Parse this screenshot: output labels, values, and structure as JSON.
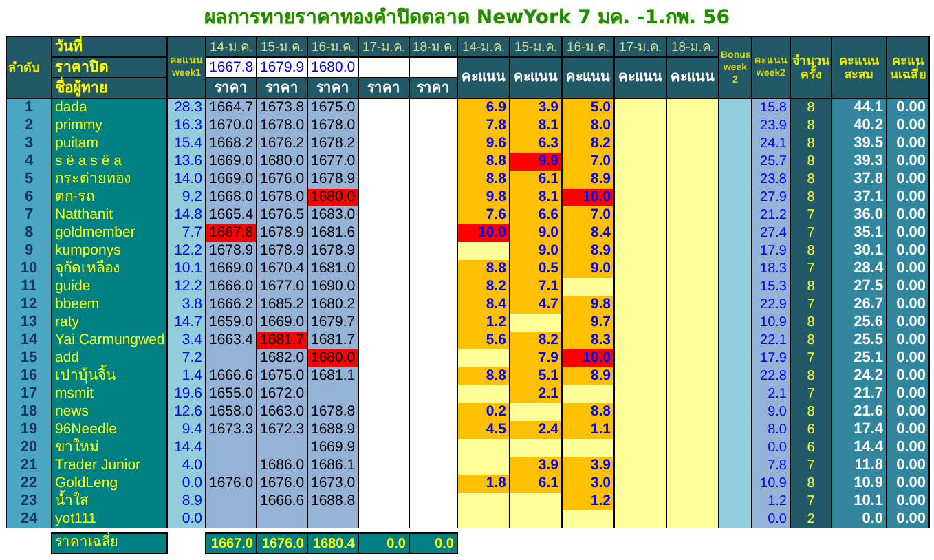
{
  "title": "ผลการทายราคาทองคำปิดตลาด NewYork 7 มค. -1.กพ. 56",
  "header": {
    "rank": "ลำดับ",
    "date_label": "วันที่",
    "closing_label": "ราคาปิด",
    "name_label": "ชื่อผู้ทาย",
    "week1": "คะแนน week1",
    "price_dates": [
      "14-ม.ค.",
      "15-ม.ค.",
      "16-ม.ค.",
      "17-ม.ค.",
      "18-ม.ค."
    ],
    "closing_prices": [
      "1667.8",
      "1679.9",
      "1680.0"
    ],
    "price_labels": [
      "ราคา",
      "ราคา",
      "ราคา",
      "ราคา",
      "ราคา"
    ],
    "score_dates": [
      "14-ม.ค.",
      "15-ม.ค.",
      "16-ม.ค.",
      "17-ม.ค.",
      "18-ม.ค."
    ],
    "score_labels": [
      "คะแนน",
      "คะแนน",
      "คะแนน",
      "คะแนน",
      "คะแนน"
    ],
    "bonus": "Bonus week 2",
    "week2": "คะแนน week2",
    "count": "จำนวนครั้ง",
    "total": "คะแนนสะสม",
    "average": "คะแนนเฉลี่ย"
  },
  "rows": [
    {
      "rank": "1",
      "name": "dada",
      "week1": "28.3",
      "prices": [
        "1664.7",
        "1673.8",
        "1675.0"
      ],
      "scores": [
        "6.9",
        "3.9",
        "5.0"
      ],
      "week2": "15.8",
      "count": "8",
      "total": "44.1",
      "average": "0.00"
    },
    {
      "rank": "2",
      "name": "primmy",
      "week1": "16.3",
      "prices": [
        "1670.0",
        "1678.0",
        "1678.0"
      ],
      "scores": [
        "7.8",
        "8.1",
        "8.0"
      ],
      "week2": "23.9",
      "count": "8",
      "total": "40.2",
      "average": "0.00"
    },
    {
      "rank": "3",
      "name": "puitam",
      "week1": "15.4",
      "prices": [
        "1668.2",
        "1676.2",
        "1678.2"
      ],
      "scores": [
        "9.6",
        "6.3",
        "8.2"
      ],
      "week2": "24.1",
      "count": "8",
      "total": "39.5",
      "average": "0.00"
    },
    {
      "rank": "4",
      "name": "s ë a s ë a",
      "week1": "13.6",
      "prices": [
        "1669.0",
        "1680.0",
        "1677.0"
      ],
      "scores": [
        "8.8",
        {
          "value": "9.9",
          "highlighted": true
        },
        "7.0"
      ],
      "week2": "25.7",
      "count": "8",
      "total": "39.3",
      "average": "0.00"
    },
    {
      "rank": "5",
      "name": "กระต่ายทอง",
      "week1": "14.0",
      "prices": [
        "1669.0",
        "1676.0",
        "1678.9"
      ],
      "scores": [
        "8.8",
        "6.1",
        "8.9"
      ],
      "week2": "23.8",
      "count": "8",
      "total": "37.8",
      "average": "0.00"
    },
    {
      "rank": "6",
      "name": "ตก-รถ",
      "week1": "9.2",
      "prices": [
        "1668.0",
        "1678.0",
        {
          "value": "1680.0",
          "highlighted": true
        }
      ],
      "scores": [
        "9.8",
        "8.1",
        {
          "value": "10.0",
          "highlighted": true
        }
      ],
      "week2": "27.9",
      "count": "8",
      "total": "37.1",
      "average": "0.00"
    },
    {
      "rank": "7",
      "name": "Natthanit",
      "week1": "14.8",
      "prices": [
        "1665.4",
        "1676.5",
        "1683.0"
      ],
      "scores": [
        "7.6",
        "6.6",
        "7.0"
      ],
      "week2": "21.2",
      "count": "7",
      "total": "36.0",
      "average": "0.00"
    },
    {
      "rank": "8",
      "name": "goldmember",
      "week1": "7.7",
      "prices": [
        {
          "value": "1667.8",
          "highlighted": true
        },
        "1678.9",
        "1681.6"
      ],
      "scores": [
        {
          "value": "10.0",
          "highlighted": true
        },
        "9.0",
        "8.4"
      ],
      "week2": "27.4",
      "count": "7",
      "total": "35.1",
      "average": "0.00"
    },
    {
      "rank": "9",
      "name": "kumponys",
      "week1": "12.2",
      "prices": [
        "1678.9",
        "1678.9",
        "1678.9"
      ],
      "scores": [
        {
          "kind": "blank"
        },
        "9.0",
        "8.9"
      ],
      "week2": "17.9",
      "count": "8",
      "total": "30.1",
      "average": "0.00"
    },
    {
      "rank": "10",
      "name": "จุกัดเหลือง",
      "week1": "10.1",
      "prices": [
        "1669.0",
        "1670.4",
        "1681.0"
      ],
      "scores": [
        "8.8",
        "0.5",
        "9.0"
      ],
      "week2": "18.3",
      "count": "7",
      "total": "28.4",
      "average": "0.00"
    },
    {
      "rank": "11",
      "name": "guide",
      "week1": "12.2",
      "prices": [
        "1666.0",
        "1677.0",
        "1690.0"
      ],
      "scores": [
        "8.2",
        "7.1"
      ],
      "week2": "15.3",
      "count": "8",
      "total": "27.5",
      "average": "0.00"
    },
    {
      "rank": "12",
      "name": "bbeem",
      "week1": "3.8",
      "prices": [
        "1666.2",
        "1685.2",
        "1680.2"
      ],
      "scores": [
        "8.4",
        "4.7",
        "9.8"
      ],
      "week2": "22.9",
      "count": "7",
      "total": "26.7",
      "average": "0.00"
    },
    {
      "rank": "13",
      "name": "raty",
      "week1": "14.7",
      "prices": [
        "1659.0",
        "1669.0",
        "1679.7"
      ],
      "scores": [
        "1.2",
        {
          "kind": "blank"
        },
        "9.7"
      ],
      "week2": "10.9",
      "count": "8",
      "total": "25.6",
      "average": "0.00"
    },
    {
      "rank": "14",
      "name": "Yai Carmungwed",
      "week1": "3.4",
      "prices": [
        "1663.4",
        {
          "value": "1681.7",
          "highlighted": true
        },
        "1681.7"
      ],
      "scores": [
        "5.6",
        "8.2",
        "8.3"
      ],
      "week2": "22.1",
      "count": "8",
      "total": "25.5",
      "average": "0.00"
    },
    {
      "rank": "15",
      "name": "add",
      "week1": "7.2",
      "prices": [
        {
          "kind": "blank"
        },
        "1682.0",
        {
          "value": "1680.0",
          "highlighted": true
        }
      ],
      "scores": [
        {
          "kind": "blank"
        },
        "7.9",
        {
          "value": "10.0",
          "highlighted": true
        }
      ],
      "week2": "17.9",
      "count": "7",
      "total": "25.1",
      "average": "0.00"
    },
    {
      "rank": "16",
      "name": "เปาบุ้นจิ้น",
      "week1": "1.4",
      "prices": [
        "1666.6",
        "1675.0",
        "1681.1"
      ],
      "scores": [
        "8.8",
        "5.1",
        "8.9"
      ],
      "week2": "22.8",
      "count": "8",
      "total": "24.2",
      "average": "0.00"
    },
    {
      "rank": "17",
      "name": "msmit",
      "week1": "19.6",
      "prices": [
        "1655.0",
        "1672.0"
      ],
      "scores": [
        {
          "kind": "blank"
        },
        "2.1"
      ],
      "week2": "2.1",
      "count": "7",
      "total": "21.7",
      "average": "0.00"
    },
    {
      "rank": "18",
      "name": "news",
      "week1": "12.6",
      "prices": [
        "1658.0",
        "1663.0",
        "1678.8"
      ],
      "scores": [
        "0.2",
        {
          "kind": "blank"
        },
        "8.8"
      ],
      "week2": "9.0",
      "count": "8",
      "total": "21.6",
      "average": "0.00"
    },
    {
      "rank": "19",
      "name": "96Needle",
      "week1": "9.4",
      "prices": [
        "1673.3",
        "1672.3",
        "1688.9"
      ],
      "scores": [
        "4.5",
        "2.4",
        "1.1"
      ],
      "week2": "8.0",
      "count": "6",
      "total": "17.4",
      "average": "0.00"
    },
    {
      "rank": "20",
      "name": "ขาใหม่",
      "week1": "14.4",
      "prices": [
        {
          "kind": "blank"
        },
        {
          "kind": "blank"
        },
        "1669.9"
      ],
      "week2": "0.0",
      "count": "6",
      "total": "14.4",
      "average": "0.00"
    },
    {
      "rank": "21",
      "name": "Trader Junior",
      "week1": "4.0",
      "prices": [
        {
          "kind": "blank"
        },
        "1686.0",
        "1686.1"
      ],
      "scores": [
        {
          "kind": "blank"
        },
        "3.9",
        "3.9"
      ],
      "week2": "7.8",
      "count": "7",
      "total": "11.8",
      "average": "0.00"
    },
    {
      "rank": "22",
      "name": "GoldLeng",
      "week1": "0.0",
      "prices": [
        "1676.0",
        "1676.0",
        "1673.0"
      ],
      "scores": [
        "1.8",
        "6.1",
        "3.0"
      ],
      "week2": "10.9",
      "count": "8",
      "total": "10.9",
      "average": "0.00"
    },
    {
      "rank": "23",
      "name": "น้ำใส",
      "week1": "8.9",
      "prices": [
        {
          "kind": "blank"
        },
        "1666.6",
        "1688.8"
      ],
      "scores": [
        {
          "kind": "blank"
        },
        {
          "kind": "blank"
        },
        "1.2"
      ],
      "week2": "1.2",
      "count": "7",
      "total": "10.1",
      "average": "0.00"
    },
    {
      "rank": "24",
      "name": "yot111",
      "week1": "0.0",
      "week2": "0.0",
      "count": "2",
      "total": "0.0",
      "average": "0.00"
    }
  ],
  "footer": {
    "label": "ราคาเฉลี่ย",
    "average_prices": [
      "1667.0",
      "1676.0",
      "1680.4",
      "0.0",
      "0.0"
    ]
  }
}
